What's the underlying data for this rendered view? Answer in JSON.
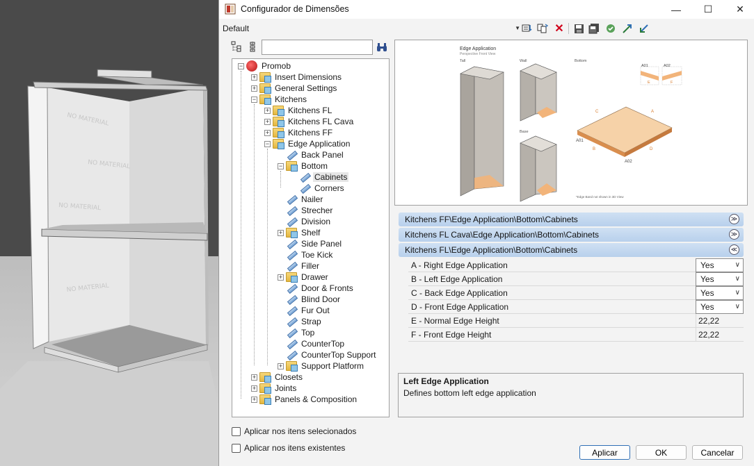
{
  "window": {
    "title": "Configurador de Dimensões",
    "minimize_glyph": "—",
    "maximize_glyph": "☐",
    "close_glyph": "✕"
  },
  "toolbar": {
    "preset": "Default",
    "icons": [
      "new-config-icon",
      "copy-config-icon",
      "delete-icon",
      "save-icon",
      "save-as-icon",
      "apply-icon",
      "import-icon",
      "export-icon"
    ]
  },
  "tree": {
    "search_value": "",
    "nodes": [
      {
        "label": "Promob"
      },
      {
        "label": "Insert Dimensions"
      },
      {
        "label": "General Settings"
      },
      {
        "label": "Kitchens"
      },
      {
        "label": "Kitchens FL"
      },
      {
        "label": "Kitchens FL Cava"
      },
      {
        "label": "Kitchens FF"
      },
      {
        "label": "Edge Application"
      },
      {
        "label": "Back Panel"
      },
      {
        "label": "Bottom"
      },
      {
        "label": "Cabinets"
      },
      {
        "label": "Corners"
      },
      {
        "label": "Nailer"
      },
      {
        "label": "Strecher"
      },
      {
        "label": "Division"
      },
      {
        "label": "Shelf"
      },
      {
        "label": "Side Panel"
      },
      {
        "label": "Toe Kick"
      },
      {
        "label": "Filler"
      },
      {
        "label": "Drawer"
      },
      {
        "label": "Door & Fronts"
      },
      {
        "label": "Blind Door"
      },
      {
        "label": "Fur Out"
      },
      {
        "label": "Strap"
      },
      {
        "label": "Top"
      },
      {
        "label": "CounterTop"
      },
      {
        "label": "CounterTop Support"
      },
      {
        "label": "Support Platform"
      },
      {
        "label": "Closets"
      },
      {
        "label": "Joints"
      },
      {
        "label": "Panels & Composition"
      }
    ]
  },
  "preview": {
    "title": "Edge Application",
    "subtitle": "Perspective Front View",
    "label_tall": "Tall",
    "label_wall": "Wall",
    "label_bottom": "Bottom",
    "label_base": "Base",
    "footnote": "*Edge Band not shown in 3D View",
    "marks": {
      "a": "A",
      "b": "B",
      "c": "C",
      "d": "D",
      "e": "E",
      "f": "F",
      "a01": "A01",
      "a02": "A02"
    },
    "accent": "#f2b47a"
  },
  "groups": [
    {
      "label": "Kitchens FF\\Edge Application\\Bottom\\Cabinets",
      "toggle": "≫"
    },
    {
      "label": "Kitchens FL Cava\\Edge Application\\Bottom\\Cabinets",
      "toggle": "≫"
    },
    {
      "label": "Kitchens FL\\Edge Application\\Bottom\\Cabinets",
      "toggle": "≪"
    }
  ],
  "properties": [
    {
      "name": "A - Right Edge Application",
      "value": "Yes"
    },
    {
      "name": "B - Left Edge Application",
      "value": "Yes"
    },
    {
      "name": "C - Back Edge Application",
      "value": "Yes"
    },
    {
      "name": "D - Front Edge Application",
      "value": "Yes"
    },
    {
      "name": "E - Normal Edge Height",
      "value": "22,22"
    },
    {
      "name": "F - Front Edge Height",
      "value": "22,22"
    }
  ],
  "description": {
    "title": "Left Edge Application",
    "text": "Defines bottom left edge application"
  },
  "options": {
    "apply_selected": "Aplicar nos itens selecionados",
    "apply_existing": "Aplicar nos itens existentes"
  },
  "buttons": {
    "apply": "Aplicar",
    "ok": "OK",
    "cancel": "Cancelar"
  }
}
